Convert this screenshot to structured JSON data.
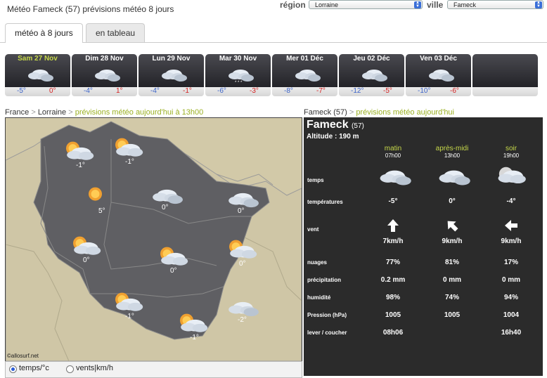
{
  "header": {
    "title": "Météo Fameck (57) prévisions météo 8 jours",
    "region_label": "région",
    "region_value": "Lorraine",
    "ville_label": "ville",
    "ville_value": "Fameck"
  },
  "tabs": [
    {
      "label": "météo à 8 jours",
      "active": true
    },
    {
      "label": "en tableau",
      "active": false
    }
  ],
  "days": [
    {
      "label": "Sam 27 Nov",
      "min": "-5°",
      "max": "0°",
      "icon": "partly-cloudy-icon",
      "today": true
    },
    {
      "label": "Dim 28 Nov",
      "min": "-4°",
      "max": "1°",
      "icon": "partly-cloudy-icon",
      "today": false
    },
    {
      "label": "Lun 29 Nov",
      "min": "-4°",
      "max": "-1°",
      "icon": "partly-cloudy-icon",
      "today": false
    },
    {
      "label": "Mar 30 Nov",
      "min": "-6°",
      "max": "-3°",
      "icon": "snow-cloud-icon",
      "today": false
    },
    {
      "label": "Mer 01 Déc",
      "min": "-8°",
      "max": "-7°",
      "icon": "partly-cloudy-icon",
      "today": false
    },
    {
      "label": "Jeu 02 Déc",
      "min": "-12°",
      "max": "-5°",
      "icon": "partly-cloudy-icon",
      "today": false
    },
    {
      "label": "Ven 03 Déc",
      "min": "-10°",
      "max": "-6°",
      "icon": "partly-cloudy-icon",
      "today": false
    }
  ],
  "map_crumb": {
    "france": "France",
    "sep": ">",
    "region": "Lorraine",
    "desc": "prévisions météo aujourd'hui à 13h00"
  },
  "panel_crumb": {
    "city": "Fameck (57)",
    "sep": ">",
    "desc": "prévisions météo aujourd'hui"
  },
  "map": {
    "credit": "©allosurf.net",
    "points": [
      {
        "temp": "-1°",
        "icon": "sun-cloud-icon"
      },
      {
        "temp": "-1°",
        "icon": "sun-cloud-icon"
      },
      {
        "temp": "5°",
        "icon": "sun-icon"
      },
      {
        "temp": "0°",
        "icon": "cloud-icon"
      },
      {
        "temp": "0°",
        "icon": "cloud-icon"
      },
      {
        "temp": "0°",
        "icon": "sun-cloud-icon"
      },
      {
        "temp": "0°",
        "icon": "sun-cloud-icon"
      },
      {
        "temp": "0°",
        "icon": "sun-cloud-icon"
      },
      {
        "temp": "-1°",
        "icon": "sun-cloud-icon"
      },
      {
        "temp": "-1°",
        "icon": "sun-cloud-icon"
      },
      {
        "temp": "-2°",
        "icon": "cloud-icon"
      }
    ]
  },
  "radios": [
    {
      "label": "temps/°c",
      "checked": true
    },
    {
      "label": "vents|km/h",
      "checked": false
    }
  ],
  "panel": {
    "city": "Fameck",
    "dept": "(57)",
    "altitude": "Altitude : 190 m",
    "columns": [
      {
        "label": "matin",
        "time": "07h00"
      },
      {
        "label": "après-midi",
        "time": "13h00"
      },
      {
        "label": "soir",
        "time": "19h00"
      }
    ],
    "rows": {
      "temps": "temps",
      "temperatures": "températures",
      "vent": "vent",
      "nuages": "nuages",
      "precipitation": "précipitation",
      "humidite": "humidité",
      "pression": "Pression (hPa)",
      "lever": "lever / coucher"
    },
    "values": {
      "temperatures": [
        "-5°",
        "0°",
        "-4°"
      ],
      "vent": [
        "7km/h",
        "9km/h",
        "9km/h"
      ],
      "nuages": [
        "77%",
        "81%",
        "17%"
      ],
      "precipitation": [
        "0.2 mm",
        "0 mm",
        "0 mm"
      ],
      "humidite": [
        "98%",
        "74%",
        "94%"
      ],
      "pression": [
        "1005",
        "1005",
        "1004"
      ],
      "lever": [
        "08h06",
        "",
        "16h40"
      ]
    },
    "wind_dirs": [
      "north",
      "north-west",
      "west"
    ]
  },
  "colors": {
    "accent_green": "#c6d84a",
    "panel_bg": "#2b2b2b",
    "min_blue": "#3a62c8",
    "max_red": "#d42020"
  }
}
